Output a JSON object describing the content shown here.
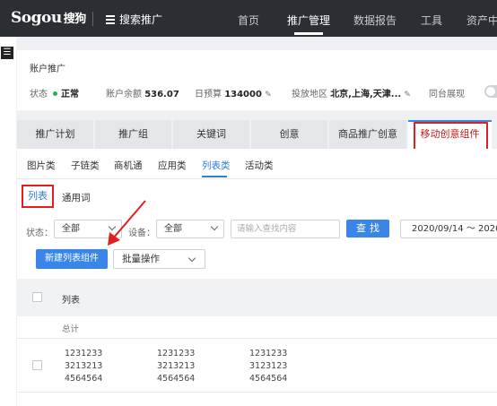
{
  "topbar": {
    "logo": "Sogou",
    "logo_cn": "搜狗",
    "product": "搜索推广",
    "nav": [
      "首页",
      "推广管理",
      "数据报告",
      "工具",
      "资产中"
    ]
  },
  "account": {
    "title": "账户推广",
    "status_label": "状态",
    "status_value": "正常",
    "balance_label": "账户余额",
    "balance_value": "536.07",
    "budget_label": "日预算",
    "budget_value": "134000",
    "region_label": "投放地区",
    "region_value": "北京,上海,天津...",
    "sync_label": "同台展现"
  },
  "tabs": [
    "推广计划",
    "推广组",
    "关键词",
    "创意",
    "商品推广创意",
    "移动创意组件"
  ],
  "subtabs": [
    "图片类",
    "子链类",
    "商机通",
    "应用类",
    "列表类",
    "活动类"
  ],
  "view_tabs": {
    "list": "列表",
    "common": "通用词"
  },
  "filters": {
    "status_label": "状态：",
    "status_value": "全部",
    "device_label": "设备：",
    "device_value": "全部",
    "search_placeholder": "请输入查找内容",
    "find_label": "查找",
    "date_range": "2020/09/14 ～ 2020"
  },
  "actions": {
    "new_label": "新建列表组件",
    "batch_label": "批量操作"
  },
  "table": {
    "header": "列表",
    "total_label": "总计",
    "rows": [
      {
        "cells": [
          [
            "1231233",
            "3213213",
            "4564564"
          ],
          [
            "1231233",
            "3213213",
            "4564564"
          ],
          [
            "1231233",
            "3123123",
            "4564564"
          ]
        ]
      }
    ]
  },
  "colors": {
    "accent": "#3a86e8",
    "highlight": "#e02020",
    "topbar": "#2b2e33",
    "status_ok": "#1fb35c"
  }
}
